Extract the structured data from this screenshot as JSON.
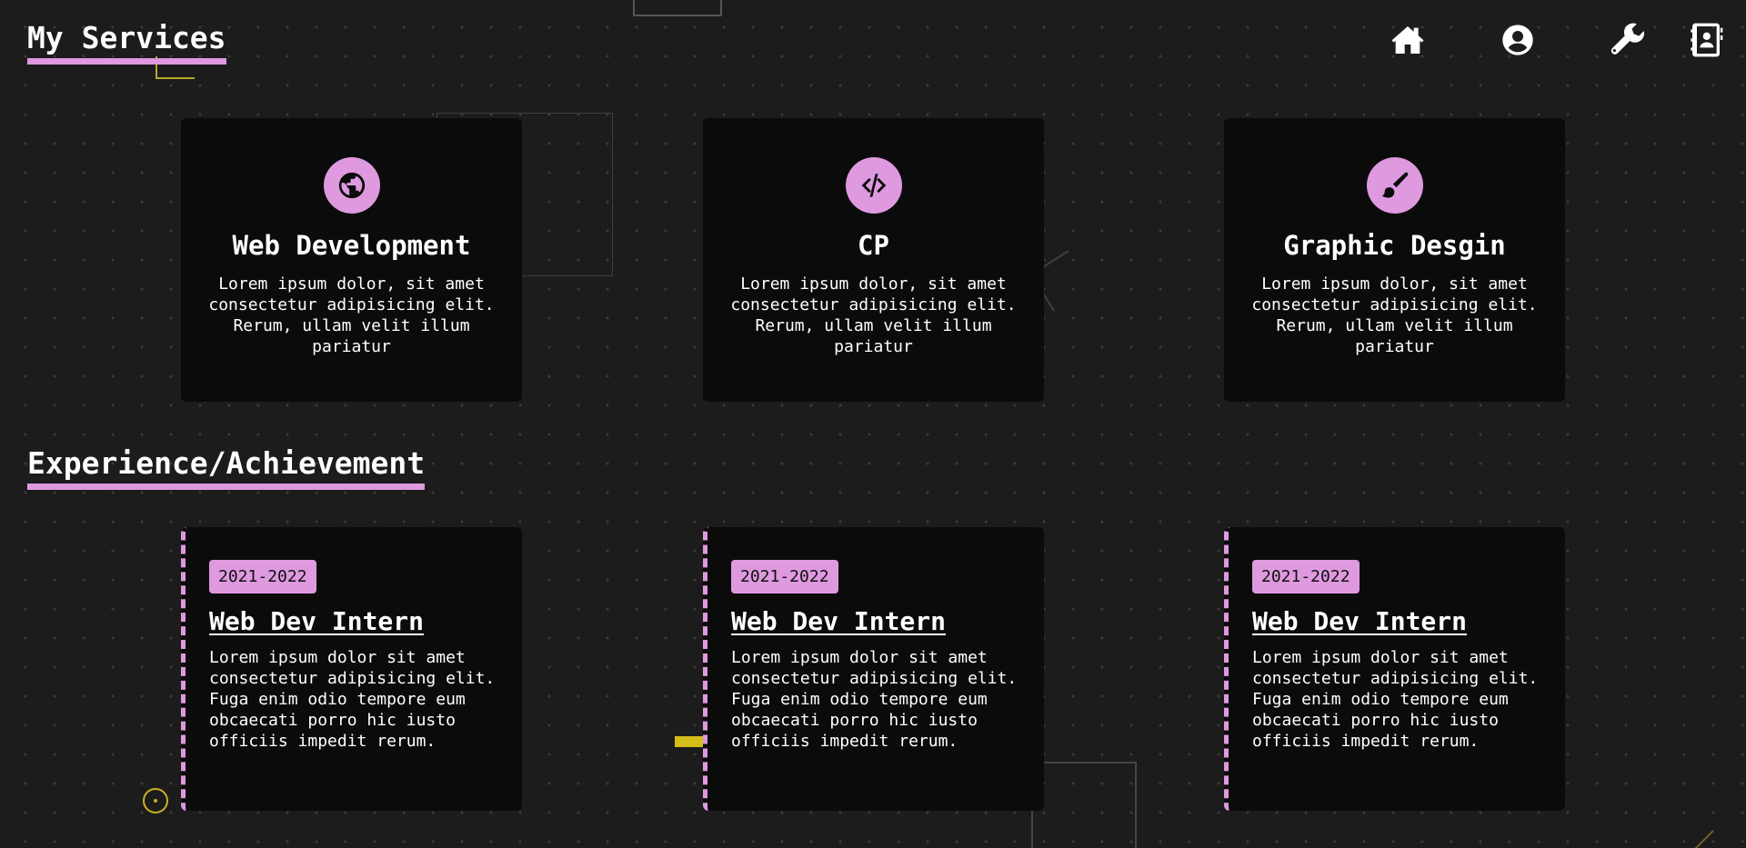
{
  "colors": {
    "accent": "#df99df",
    "background": "#1c1c1c",
    "card": "#0b0b0b",
    "decor_yellow": "#c9b21f"
  },
  "services": {
    "title": "My Services",
    "cards": [
      {
        "icon": "globe-icon",
        "title": "Web Development",
        "description": "Lorem ipsum dolor, sit amet consectetur adipisicing elit. Rerum, ullam velit illum pariatur"
      },
      {
        "icon": "code-icon",
        "title": "CP",
        "description": "Lorem ipsum dolor, sit amet consectetur adipisicing elit. Rerum, ullam velit illum pariatur"
      },
      {
        "icon": "paintbrush-icon",
        "title": "Graphic Desgin",
        "description": "Lorem ipsum dolor, sit amet consectetur adipisicing elit. Rerum, ullam velit illum pariatur"
      }
    ]
  },
  "nav": {
    "items": [
      {
        "icon": "home-icon"
      },
      {
        "icon": "user-icon"
      },
      {
        "icon": "wrench-icon"
      },
      {
        "icon": "contact-book-icon"
      }
    ]
  },
  "experience": {
    "title": "Experience/Achievement",
    "cards": [
      {
        "date": "2021-2022",
        "title": "Web Dev Intern",
        "description": "Lorem ipsum dolor sit amet consectetur adipisicing elit. Fuga enim odio tempore eum obcaecati porro hic iusto officiis impedit rerum."
      },
      {
        "date": "2021-2022",
        "title": "Web Dev Intern",
        "description": "Lorem ipsum dolor sit amet consectetur adipisicing elit. Fuga enim odio tempore eum obcaecati porro hic iusto officiis impedit rerum."
      },
      {
        "date": "2021-2022",
        "title": "Web Dev Intern",
        "description": "Lorem ipsum dolor sit amet consectetur adipisicing elit. Fuga enim odio tempore eum obcaecati porro hic iusto officiis impedit rerum."
      }
    ]
  }
}
